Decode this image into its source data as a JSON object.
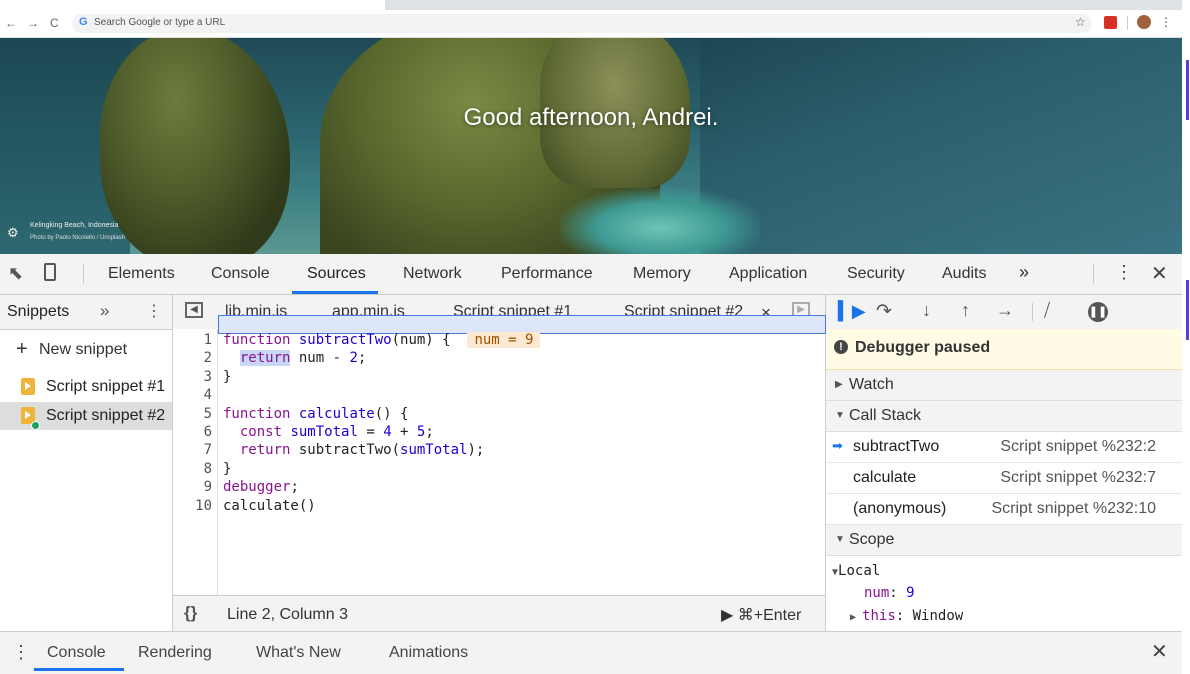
{
  "browser": {
    "omnibox_placeholder": "Search Google or type a URL",
    "google_letter": "G"
  },
  "hero": {
    "greeting": "Good afternoon, Andrei.",
    "photo_location": "Kelingking Beach, Indonesia",
    "photo_credit": "Photo by Paolo Nicolello / Unsplash"
  },
  "devtools": {
    "tabs": [
      "Elements",
      "Console",
      "Sources",
      "Network",
      "Performance",
      "Memory",
      "Application",
      "Security",
      "Audits"
    ],
    "active_tab": "Sources",
    "more_tabs": "»"
  },
  "sidebar": {
    "title": "Snippets",
    "more": "»",
    "new_snippet": "New snippet",
    "snippets": [
      "Script snippet #1",
      "Script snippet #2"
    ],
    "selected_snippet": "Script snippet #2"
  },
  "editor": {
    "tabs": [
      "lib.min.js",
      "app.min.js",
      "Script snippet #1",
      "Script snippet #2"
    ],
    "active_tab": "Script snippet #2",
    "close_glyph": "×",
    "line_numbers": [
      "1",
      "2",
      "3",
      "4",
      "5",
      "6",
      "7",
      "8",
      "9",
      "10"
    ],
    "inline_value": "num = 9",
    "status_position": "Line 2, Column 3",
    "run_shortcut": "⌘+Enter",
    "pretty_print": "{}"
  },
  "debugger": {
    "paused_label": "Debugger paused",
    "watch_label": "Watch",
    "call_stack_label": "Call Stack",
    "scope_label": "Scope",
    "call_stack": [
      {
        "fn": "subtractTwo",
        "loc": "Script snippet %232:2",
        "current": true
      },
      {
        "fn": "calculate",
        "loc": "Script snippet %232:7",
        "current": false
      },
      {
        "fn": "(anonymous)",
        "loc": "Script snippet %232:10",
        "current": false
      }
    ],
    "scope": {
      "local_label": "Local",
      "num_key": "num",
      "num_val": "9",
      "this_key": "this",
      "this_val": "Window"
    }
  },
  "drawer": {
    "tabs": [
      "Console",
      "Rendering",
      "What's New",
      "Animations"
    ],
    "active_tab": "Console"
  },
  "colors": {
    "accent": "#1a73e8",
    "paused_bg": "#fffbe5",
    "exec_line_bg": "#dde6fb",
    "keyword": "#881391",
    "snippet_icon": "#f0b43a"
  }
}
